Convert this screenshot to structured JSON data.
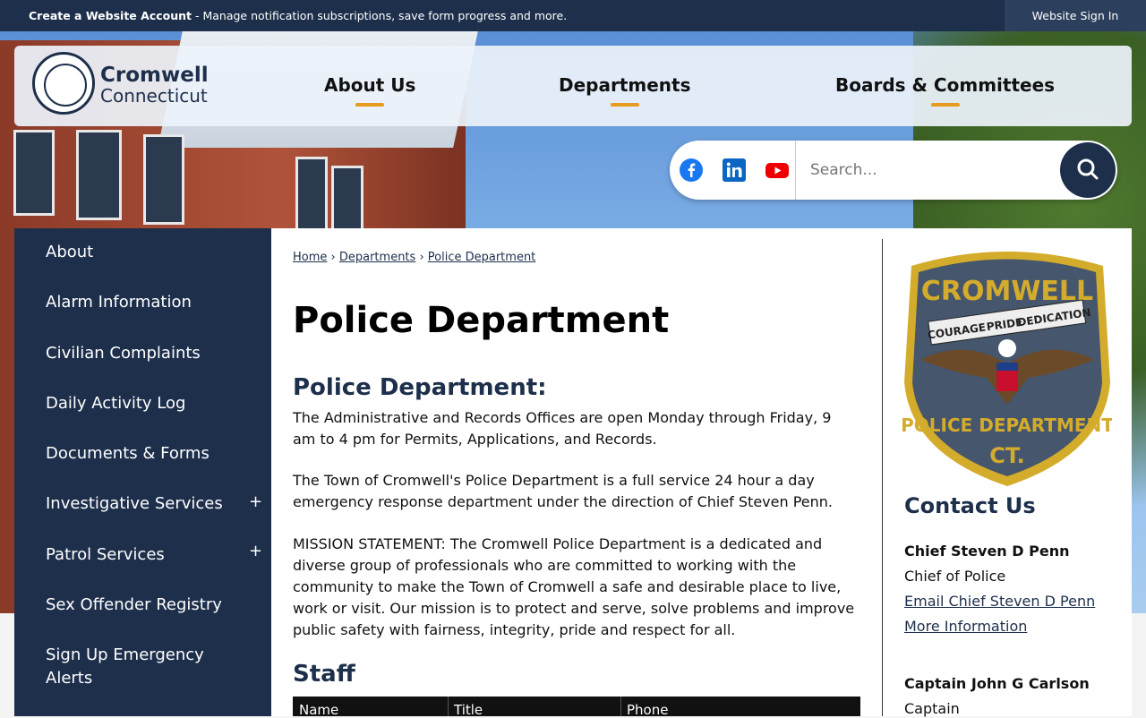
{
  "topbar": {
    "account_strong": "Create a Website Account",
    "account_rest": " - Manage notification subscriptions, save form progress and more.",
    "signin": "Website Sign In"
  },
  "logo": {
    "line1": "Cromwell",
    "line2": "Connecticut"
  },
  "nav": {
    "items": [
      "About Us",
      "Departments",
      "Boards & Committees"
    ]
  },
  "search": {
    "placeholder": "Search..."
  },
  "sidebar": {
    "items": [
      "About",
      "Alarm Information",
      "Civilian Complaints",
      "Daily Activity Log",
      "Documents & Forms",
      "Investigative Services",
      "Patrol Services",
      "Sex Offender Registry",
      "Sign Up Emergency Alerts"
    ]
  },
  "breadcrumb": [
    "Home",
    "Departments",
    "Police Department"
  ],
  "page": {
    "title": "Police Department",
    "section_title": "Police Department:",
    "para1": "The Administrative and Records Offices are open Monday through Friday, 9 am to 4 pm for Permits, Applications, and Records.",
    "para2": "The Town of Cromwell's Police Department is a full service 24 hour a day emergency response department under the direction of Chief Steven Penn.",
    "para3": "MISSION STATEMENT: The Cromwell Police Department is a dedicated and diverse group of professionals who are committed to working with the community to make the Town of Cromwell a safe and desirable place to live, work or visit. Our mission is to protect and serve, solve problems and improve public safety with fairness, integrity, pride and respect for all.",
    "staff_title": "Staff",
    "table_headers": [
      "Name",
      "Title",
      "Phone"
    ]
  },
  "badge": {
    "top": "CROMWELL",
    "banner": [
      "COURAGE",
      "PRIDE",
      "DEDICATION"
    ],
    "bottom": "POLICE DEPARTMENT",
    "state": "CT."
  },
  "contact": {
    "title": "Contact Us",
    "person1_name": "Chief Steven D Penn",
    "person1_title": "Chief of Police",
    "person1_email": "Email Chief Steven D Penn",
    "person1_more": "More Information",
    "person2_name": "Captain John G Carlson",
    "person2_title": "Captain"
  },
  "colors": {
    "navy": "#1d2f4b",
    "accent": "#e89a1e"
  }
}
